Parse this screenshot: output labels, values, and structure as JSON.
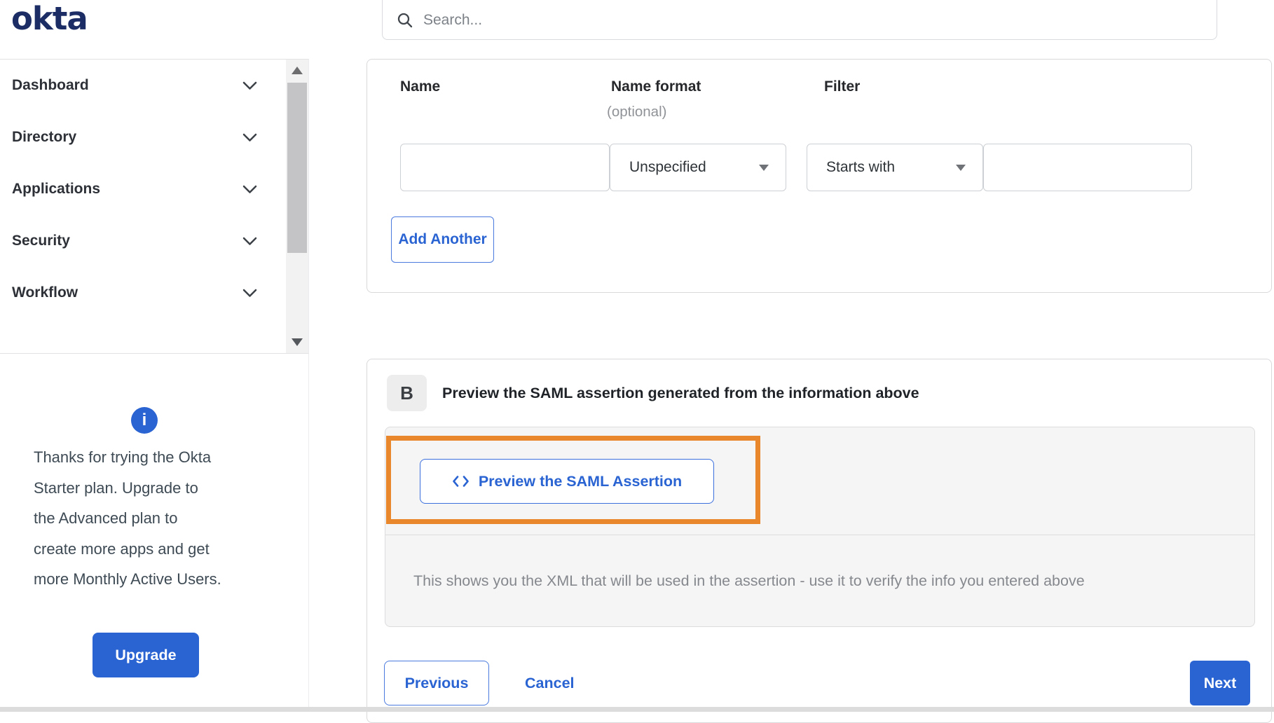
{
  "brand": {
    "logo_text": "okta"
  },
  "search": {
    "placeholder": "Search...",
    "icon": "search-icon"
  },
  "sidebar": {
    "items": [
      {
        "label": "Dashboard"
      },
      {
        "label": "Directory"
      },
      {
        "label": "Applications"
      },
      {
        "label": "Security"
      },
      {
        "label": "Workflow"
      }
    ],
    "plan_notice": {
      "icon": "info-icon",
      "info_glyph": "i",
      "text": "Thanks for trying the Okta\nStarter plan. Upgrade to\nthe Advanced plan to\ncreate more apps and get\nmore Monthly Active Users.",
      "upgrade_label": "Upgrade"
    }
  },
  "attribute_form": {
    "name_label": "Name",
    "name_format_label": "Name format",
    "name_format_hint": "(optional)",
    "filter_label": "Filter",
    "name_value": "",
    "name_format_selected": "Unspecified",
    "filter_type_selected": "Starts with",
    "filter_value": "",
    "add_another_label": "Add Another"
  },
  "preview_section": {
    "step_badge": "B",
    "title": "Preview the SAML assertion generated from the information above",
    "preview_button_label": "Preview the SAML Assertion",
    "code_icon": "code-brackets-icon",
    "hint": "This shows you the XML that will be used in the assertion - use it to verify the info you entered above"
  },
  "wizard_footer": {
    "previous_label": "Previous",
    "cancel_label": "Cancel",
    "next_label": "Next"
  },
  "colors": {
    "primary_blue": "#2a63d2",
    "logo_navy": "#1b2d64",
    "highlight_orange": "#e8872b",
    "panel_gray": "#f5f5f6"
  }
}
